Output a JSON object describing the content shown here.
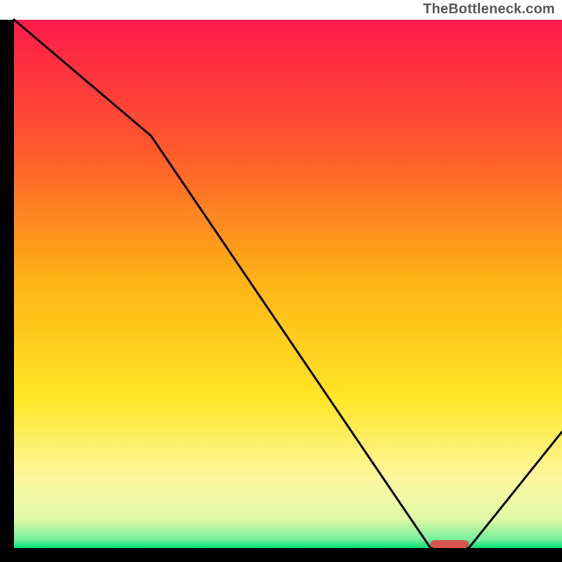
{
  "attribution": "TheBottleneck.com",
  "chart_data": {
    "type": "line",
    "title": "",
    "xlabel": "",
    "ylabel": "",
    "xlim": [
      0,
      100
    ],
    "ylim": [
      0,
      100
    ],
    "x": [
      0,
      25,
      76,
      83,
      100
    ],
    "values": [
      100,
      78,
      0,
      0,
      22
    ],
    "marker": {
      "x_range": [
        76,
        83
      ],
      "y": 0,
      "color": "#d9544f"
    },
    "background": {
      "type": "vertical-gradient",
      "stops": [
        {
          "offset": 0.0,
          "color": "#ff1a4b"
        },
        {
          "offset": 0.25,
          "color": "#ff5a2c"
        },
        {
          "offset": 0.5,
          "color": "#ffb514"
        },
        {
          "offset": 0.72,
          "color": "#ffe728"
        },
        {
          "offset": 0.87,
          "color": "#fdf7a0"
        },
        {
          "offset": 0.945,
          "color": "#e0f8a7"
        },
        {
          "offset": 0.985,
          "color": "#74ef9b"
        },
        {
          "offset": 1.0,
          "color": "#00e371"
        }
      ]
    },
    "axes": {
      "left_width": 20,
      "bottom_height": 20,
      "color": "#000000"
    },
    "curve_color": "#000000",
    "curve_width": 3
  }
}
